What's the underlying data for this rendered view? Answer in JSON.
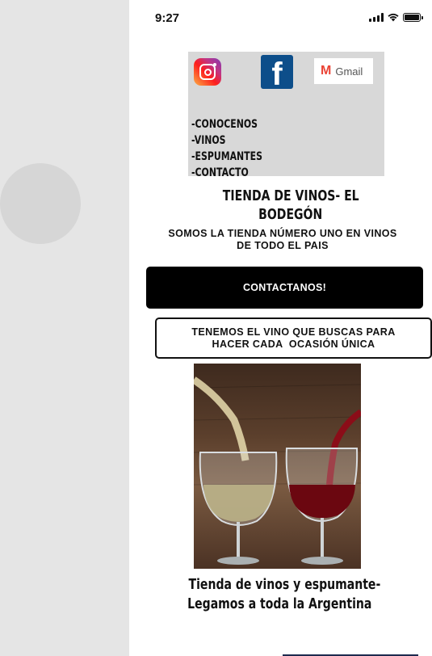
{
  "status_bar": {
    "time": "9:27"
  },
  "social": {
    "instagram": "instagram-icon",
    "facebook": "facebook-icon",
    "facebook_glyph": "f",
    "gmail_letter": "M",
    "gmail_label": "Gmail"
  },
  "menu": {
    "items": [
      {
        "label": "-CONOCENOS"
      },
      {
        "label": "-VINOS"
      },
      {
        "label": "-ESPUMANTES"
      },
      {
        "label": "-CONTACTO"
      }
    ]
  },
  "header": {
    "title_line1": "TIENDA DE VINOS- EL",
    "title_line2": "BODEGÓN",
    "subtitle_line1": "SOMOS LA TIENDA NÚMERO UNO EN VINOS",
    "subtitle_line2": "DE TODO EL PAIS"
  },
  "cta": {
    "label": "CONTACTANOS!"
  },
  "tagline": {
    "line1": "TENEMOS EL VINO QUE BUSCAS PARA",
    "line2": "HACER CADA  OCASIÓN ÚNICA"
  },
  "caption": {
    "line1": "Tienda de vinos y espumante-",
    "line2": "Legamos a toda la Argentina"
  },
  "colors": {
    "accent": "#000000",
    "facebook": "#0d4e8a",
    "wine_red": "#7a0a12",
    "panel_gray": "#d8d8d8"
  }
}
